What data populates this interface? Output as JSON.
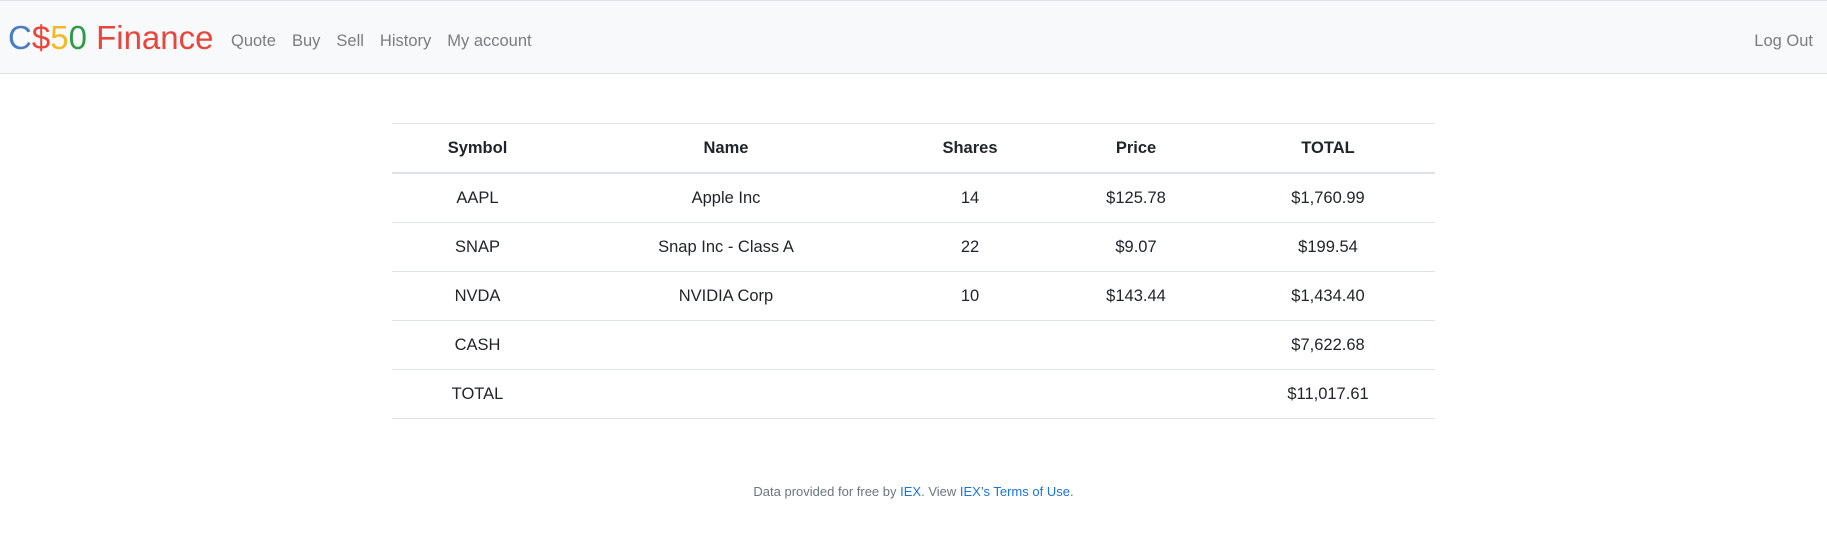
{
  "brand": {
    "parts": [
      {
        "text": "C",
        "color": "#4a7cc2"
      },
      {
        "text": "$",
        "color": "#e8453c"
      },
      {
        "text": "5",
        "color": "#f3b824"
      },
      {
        "text": "0",
        "color": "#2d9a47"
      },
      {
        "text": " Finance",
        "color": "#e8453c"
      }
    ]
  },
  "nav": {
    "items": [
      {
        "label": "Quote"
      },
      {
        "label": "Buy"
      },
      {
        "label": "Sell"
      },
      {
        "label": "History"
      },
      {
        "label": "My account"
      }
    ],
    "logout_label": "Log Out"
  },
  "table": {
    "headers": [
      "Symbol",
      "Name",
      "Shares",
      "Price",
      "TOTAL"
    ],
    "rows": [
      [
        "AAPL",
        "Apple Inc",
        "14",
        "$125.78",
        "$1,760.99"
      ],
      [
        "SNAP",
        "Snap Inc - Class A",
        "22",
        "$9.07",
        "$199.54"
      ],
      [
        "NVDA",
        "NVIDIA Corp",
        "10",
        "$143.44",
        "$1,434.40"
      ],
      [
        "CASH",
        "",
        "",
        "",
        "$7,622.68"
      ],
      [
        "TOTAL",
        "",
        "",
        "",
        "$11,017.61"
      ]
    ]
  },
  "footer": {
    "prefix": "Data provided for free by ",
    "iex_link": "IEX",
    "middle": ". View ",
    "terms_link": "IEX’s Terms of Use",
    "suffix": "."
  },
  "colors": {
    "navbar_bg": "#f8f9fa",
    "link": "#1a73d9",
    "nav_text": "#7a7d80"
  }
}
